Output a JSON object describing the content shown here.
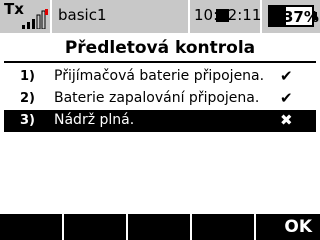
{
  "status_bar": {
    "tx_label": "Tx",
    "model_name": "basic1",
    "time": "10:12:11",
    "battery_percent": "37%",
    "battery_level": 0.37,
    "signal_icon": "signal-bars-icon"
  },
  "page": {
    "title": "Předletová kontrola"
  },
  "checklist": [
    {
      "num": "1)",
      "text": "Přijímačová baterie připojena.",
      "status": "✔"
    },
    {
      "num": "2)",
      "text": "Baterie zapalování připojena.",
      "status": "✔"
    },
    {
      "num": "3)",
      "text": "Nádrž plná.",
      "status": "✖"
    }
  ],
  "softkeys": {
    "ok_label": "OK"
  },
  "colors": {
    "status_bar": "#c8c8c8",
    "foreground": "#000000",
    "background": "#ffffff",
    "signal_alert": "#e00000"
  }
}
